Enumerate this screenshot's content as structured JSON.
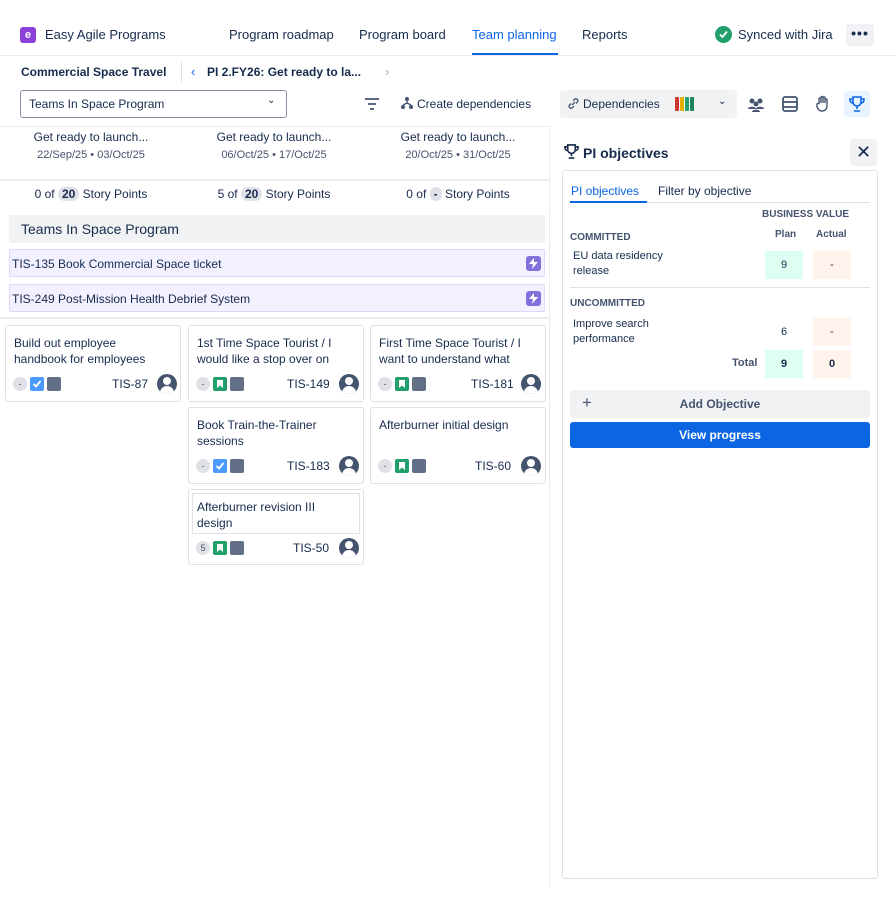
{
  "header": {
    "logo_letter": "e",
    "app_title": "Easy Agile Programs",
    "nav": [
      "Program roadmap",
      "Program board",
      "Team planning",
      "Reports"
    ],
    "active_nav": "Team planning",
    "sync_status": "Synced with Jira",
    "more_label": "•••"
  },
  "breadcrumb": {
    "program": "Commercial Space Travel",
    "increment": "PI 2.FY26: Get ready to la..."
  },
  "toolbar": {
    "team_select": "Teams In Space Program",
    "create_dependencies": "Create dependencies",
    "dependencies": "Dependencies",
    "dependency_colors": [
      "#c9372c",
      "#e2b203",
      "#22a06b",
      "#1f845a"
    ]
  },
  "sprints": [
    {
      "name": "Get ready to launch...",
      "dates": "22/Sep/25 • 03/Oct/25",
      "used": "0 of",
      "capacity": "20",
      "unit": "Story Points"
    },
    {
      "name": "Get ready to launch...",
      "dates": "06/Oct/25 • 17/Oct/25",
      "used": "5 of",
      "capacity": "20",
      "unit": "Story Points"
    },
    {
      "name": "Get ready to launch...",
      "dates": "20/Oct/25 • 31/Oct/25",
      "used": "0 of",
      "capacity": "-",
      "unit": "Story Points"
    }
  ],
  "team_group": "Teams In Space Program",
  "features": [
    "TIS-135 Book Commercial Space ticket",
    "TIS-249 Post-Mission Health Debrief System"
  ],
  "cards": [
    {
      "title": "Build out employee handbook for employees",
      "points": "-",
      "type": "task",
      "key": "TIS-87"
    },
    {
      "title": "1st Time Space Tourist / I would like a stop over on",
      "points": "-",
      "type": "story",
      "key": "TIS-149"
    },
    {
      "title": "First Time Space Tourist / I want to understand what",
      "points": "-",
      "type": "story",
      "key": "TIS-181"
    },
    {
      "title": "Book Train-the-Trainer sessions",
      "points": "-",
      "type": "task",
      "key": "TIS-183"
    },
    {
      "title": "Afterburner initial design",
      "points": "-",
      "type": "story",
      "key": "TIS-60"
    },
    {
      "title": "Afterburner revision III design",
      "points": "5",
      "type": "story",
      "key": "TIS-50"
    }
  ],
  "objectives_panel": {
    "title": "PI objectives",
    "close": "✕",
    "tabs": [
      "PI objectives",
      "Filter by objective"
    ],
    "business_value": "BUSINESS VALUE",
    "col_plan": "Plan",
    "col_actual": "Actual",
    "committed_label": "COMMITTED",
    "committed": [
      {
        "name": "EU data residency release",
        "plan": "9",
        "actual": "-"
      }
    ],
    "uncommitted_label": "UNCOMMITTED",
    "uncommitted": [
      {
        "name": "Improve search performance",
        "plan": "6",
        "actual": "-"
      }
    ],
    "total_label": "Total",
    "total_plan": "9",
    "total_actual": "0",
    "add_objective": "Add Objective",
    "view_progress": "View progress"
  }
}
